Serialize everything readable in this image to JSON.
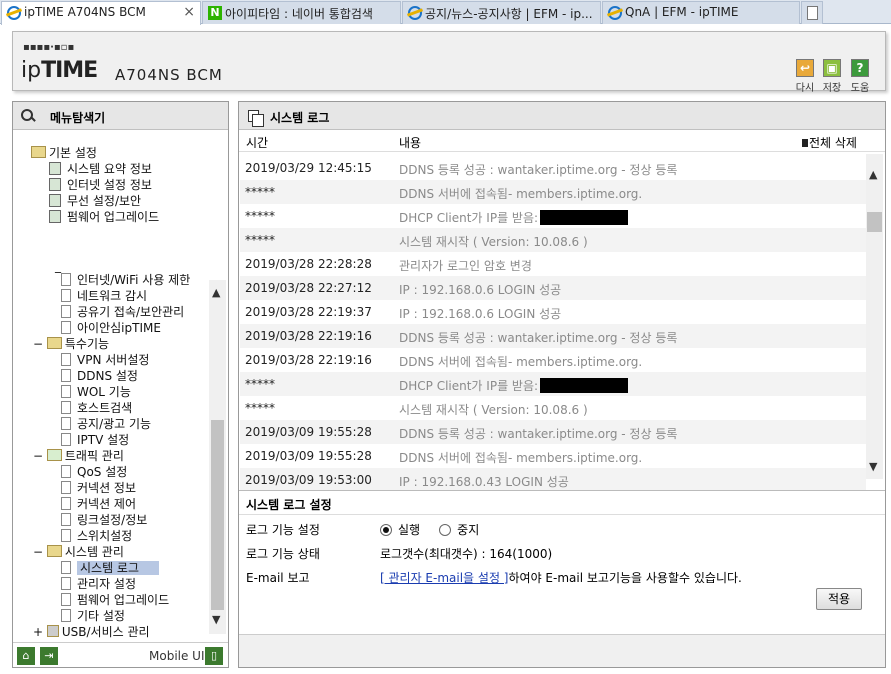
{
  "tabs": [
    {
      "label": "ipTIME A704NS BCM",
      "icon": "ie-icon",
      "active": true
    },
    {
      "label": "아이피타임 : 네이버 통합검색",
      "icon": "naver-icon"
    },
    {
      "label": "공지/뉴스-공지사항 | EFM - ip...",
      "icon": "ie-icon"
    },
    {
      "label": "QnA | EFM - ipTIME",
      "icon": "ie-icon"
    }
  ],
  "header": {
    "dots": "▪▪▪▪·▪▫▪",
    "brand_ip": "ip",
    "brand_time": "TIME",
    "model": "A704NS BCM",
    "buttons": [
      {
        "label": "다시",
        "icon": "reload-icon",
        "glyph": "↩",
        "color": "#e9a93a"
      },
      {
        "label": "저장",
        "icon": "save-icon",
        "glyph": "▣",
        "color": "#8cbf3f"
      },
      {
        "label": "도움",
        "icon": "help-icon",
        "glyph": "?",
        "color": "#3c9a3c"
      }
    ]
  },
  "left": {
    "title": "메뉴탐색기",
    "basic": {
      "label": "기본 설정",
      "items": [
        "시스템 요약 정보",
        "인터넷 설정 정보",
        "무선 설정/보안",
        "펌웨어 업그레이드"
      ]
    },
    "misc_items": [
      "인터넷/WiFi 사용 제한",
      "네트워크 감시",
      "공유기 접속/보안관리",
      "아이안심ipTIME"
    ],
    "special": {
      "label": "특수기능",
      "items": [
        "VPN 서버설정",
        "DDNS 설정",
        "WOL 기능",
        "호스트검색",
        "공지/광고 기능",
        "IPTV 설정"
      ]
    },
    "traffic": {
      "label": "트래픽 관리",
      "items": [
        "QoS 설정",
        "커넥션 정보",
        "커넥션 제어",
        "링크설정/정보",
        "스위치설정"
      ]
    },
    "system": {
      "label": "시스템 관리",
      "items": [
        "시스템 로그",
        "관리자 설정",
        "펌웨어 업그레이드",
        "기타 설정"
      ],
      "selected": "시스템 로그"
    },
    "usb": {
      "label": "USB/서비스 관리"
    },
    "footer": {
      "mobile": "Mobile UI"
    }
  },
  "right": {
    "title": "시스템 로그",
    "col_time": "시간",
    "col_content": "내용",
    "delete_all": "전체 삭제",
    "logs": [
      {
        "time": "2019/03/29 12:45:15",
        "msg": "DDNS 등록 성공 : wantaker.iptime.org - 정상 등록"
      },
      {
        "time": "*****",
        "msg": "DDNS 서버에 접속됨- members.iptime.org."
      },
      {
        "time": "*****",
        "msg": "DHCP Client가 IP를 받음:",
        "redacted": true
      },
      {
        "time": "*****",
        "msg": "시스템 재시작 ( Version: 10.08.6 )"
      },
      {
        "time": "2019/03/28 22:28:28",
        "msg": "관리자가 로그인 암호 변경"
      },
      {
        "time": "2019/03/28 22:27:12",
        "msg": "IP : 192.168.0.6 LOGIN 성공"
      },
      {
        "time": "2019/03/28 22:19:37",
        "msg": "IP : 192.168.0.6 LOGIN 성공"
      },
      {
        "time": "2019/03/28 22:19:16",
        "msg": "DDNS 등록 성공 : wantaker.iptime.org - 정상 등록"
      },
      {
        "time": "2019/03/28 22:19:16",
        "msg": "DDNS 서버에 접속됨- members.iptime.org."
      },
      {
        "time": "*****",
        "msg": "DHCP Client가 IP를 받음:",
        "redacted": true
      },
      {
        "time": "*****",
        "msg": "시스템 재시작 ( Version: 10.08.6 )"
      },
      {
        "time": "2019/03/09 19:55:28",
        "msg": "DDNS 등록 성공 : wantaker.iptime.org - 정상 등록"
      },
      {
        "time": "2019/03/09 19:55:28",
        "msg": "DDNS 서버에 접속됨- members.iptime.org."
      },
      {
        "time": "2019/03/09 19:53:00",
        "msg": "IP : 192.168.0.43 LOGIN 성공"
      }
    ],
    "settings": {
      "title": "시스템 로그 설정",
      "log_func_label": "로그 기능 설정",
      "opt_run": "실행",
      "opt_stop": "중지",
      "log_status_label": "로그 기능 상태",
      "log_status_value": "로그갯수(최대갯수) : 164(1000)",
      "email_label": "E-mail 보고",
      "email_link": "[ 관리자 E-mail을 설정 ]",
      "email_text": "하여야 E-mail 보고기능을 사용할수 있습니다.",
      "apply": "적용"
    }
  }
}
